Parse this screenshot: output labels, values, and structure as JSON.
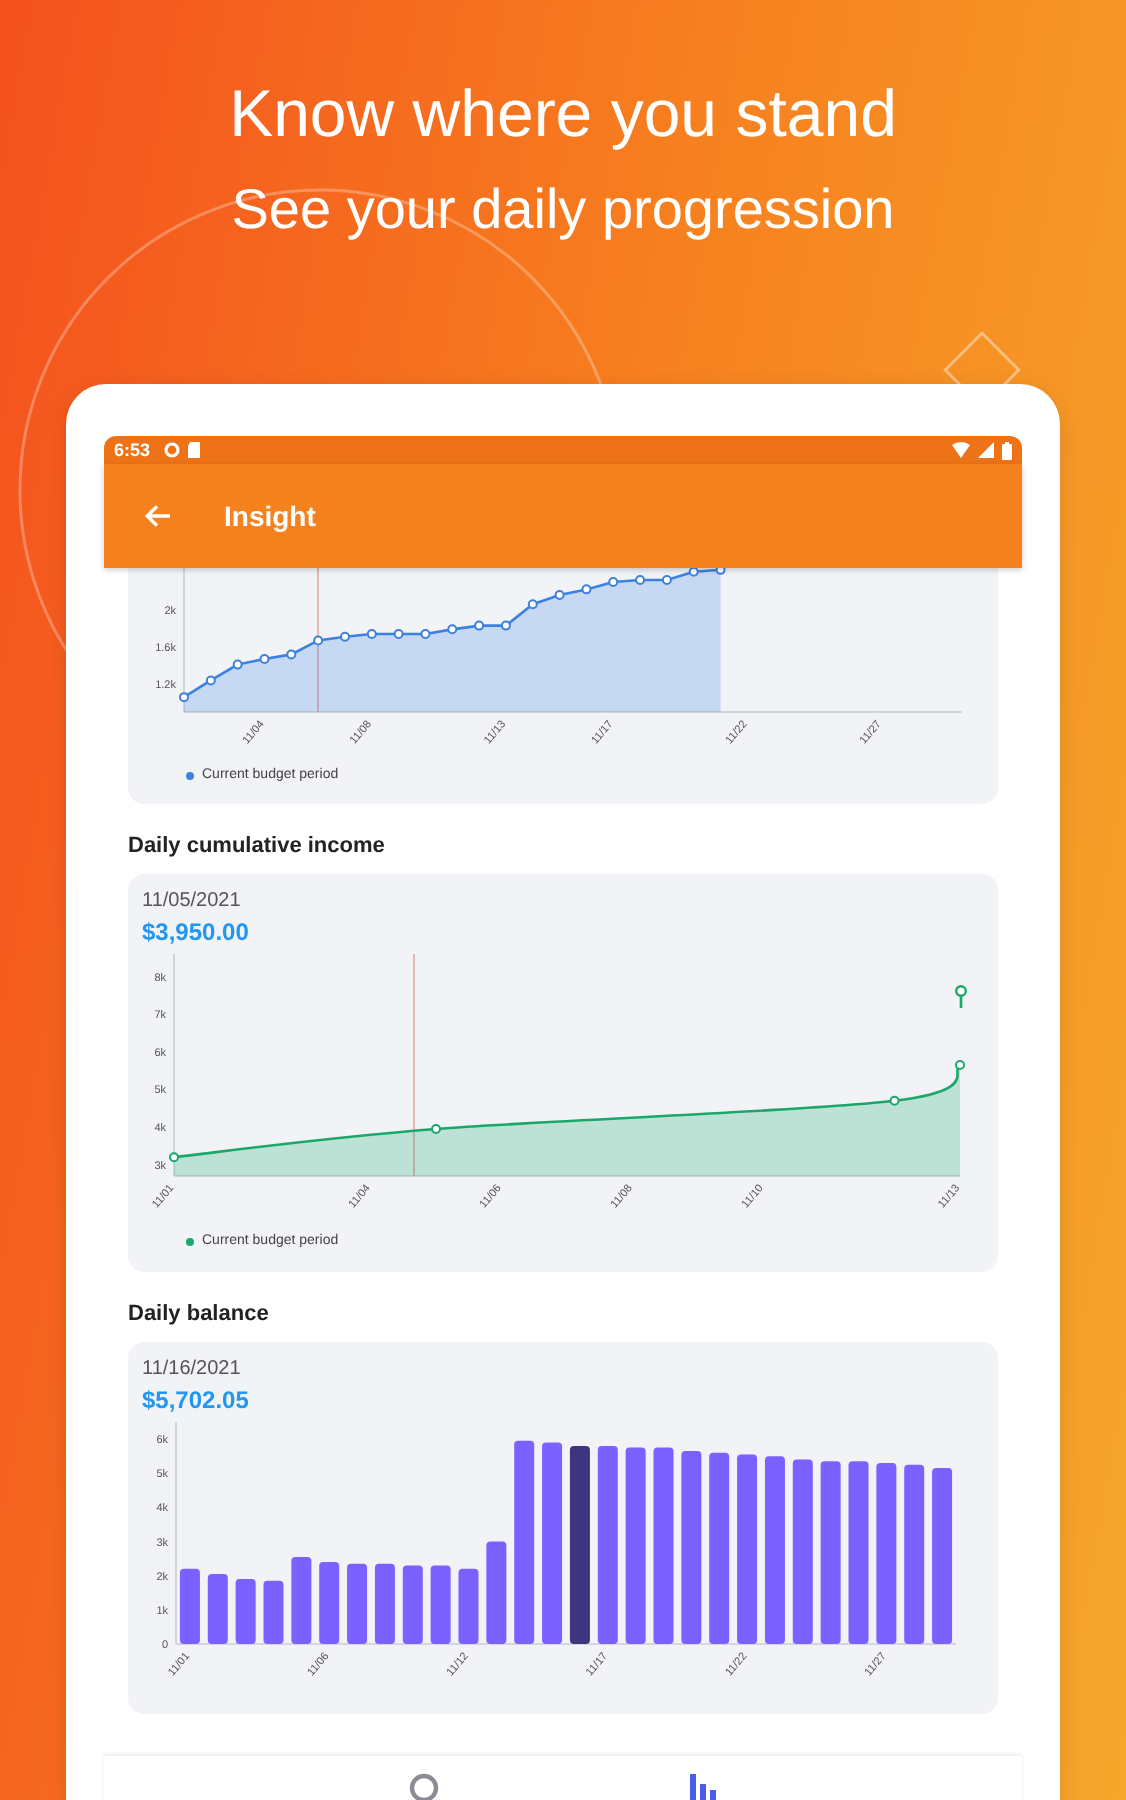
{
  "headline": {
    "title": "Know where you stand",
    "subtitle": "See your daily progression"
  },
  "status_bar": {
    "time": "6:53"
  },
  "app_bar": {
    "title": "Insight"
  },
  "sections": [
    {
      "chart_data": {
        "type": "area",
        "categories": [
          null,
          null,
          null,
          "11/04",
          null,
          null,
          null,
          "11/08",
          null,
          null,
          null,
          null,
          "11/13",
          null,
          null,
          null,
          "11/17",
          null,
          null,
          null,
          null,
          "11/22",
          null,
          null,
          null,
          null,
          "11/27",
          null,
          null,
          null
        ],
        "ylim": [
          900,
          2450
        ],
        "yticks": [
          {
            "value": 1200,
            "label": "1.2k"
          },
          {
            "value": 1600,
            "label": "1.6k"
          },
          {
            "value": 2000,
            "label": "2k"
          }
        ],
        "series": [
          {
            "name": "Current budget period",
            "color": "#3b82e0",
            "values": [
              1060,
              1240,
              1410,
              1470,
              1520,
              1670,
              1710,
              1740,
              1740,
              1740,
              1790,
              1830,
              1830,
              2060,
              2160,
              2220,
              2300,
              2320,
              2320,
              2410,
              2430,
              null,
              null,
              null,
              null,
              null,
              null,
              null,
              null,
              null
            ]
          }
        ]
      }
    },
    {
      "title": "Daily cumulative income",
      "selected_date": "11/05/2021",
      "selected_value": "$3,950.00",
      "chart_data": {
        "type": "area",
        "categories": [
          "11/01",
          null,
          null,
          "11/04",
          null,
          "11/06",
          null,
          "11/08",
          null,
          "11/10",
          null,
          null,
          "11/13"
        ],
        "ylim": [
          2700,
          8600
        ],
        "yticks": [
          {
            "value": 3000,
            "label": "3k"
          },
          {
            "value": 4000,
            "label": "4k"
          },
          {
            "value": 5000,
            "label": "5k"
          },
          {
            "value": 6000,
            "label": "6k"
          },
          {
            "value": 7000,
            "label": "7k"
          },
          {
            "value": 8000,
            "label": "8k"
          }
        ],
        "series": [
          {
            "name": "Current budget period",
            "color": "#1aa86a",
            "values": [
              3200,
              null,
              null,
              null,
              3950,
              null,
              null,
              null,
              null,
              null,
              null,
              4700,
              5650
            ]
          }
        ]
      }
    },
    {
      "title": "Daily balance",
      "selected_date": "11/16/2021",
      "selected_value": "$5,702.05",
      "chart_data": {
        "type": "bar",
        "categories": [
          "11/01",
          null,
          null,
          null,
          null,
          "11/06",
          null,
          null,
          null,
          null,
          "11/12",
          null,
          null,
          null,
          null,
          "11/17",
          null,
          null,
          null,
          null,
          "11/22",
          null,
          null,
          null,
          null,
          "11/27",
          null,
          null
        ],
        "ylim": [
          0,
          6500
        ],
        "yticks": [
          {
            "value": 0,
            "label": "0"
          },
          {
            "value": 1000,
            "label": "1k"
          },
          {
            "value": 2000,
            "label": "2k"
          },
          {
            "value": 3000,
            "label": "3k"
          },
          {
            "value": 4000,
            "label": "4k"
          },
          {
            "value": 5000,
            "label": "5k"
          },
          {
            "value": 6000,
            "label": "6k"
          }
        ],
        "series": [
          {
            "color": "#7b61ff",
            "values": [
              2200,
              2050,
              1900,
              1850,
              2550,
              2400,
              2350,
              2350,
              2300,
              2300,
              2200,
              3000,
              5950,
              5900,
              null,
              5800,
              5750,
              5750,
              5650,
              5600,
              5550,
              5500,
              5400,
              5350,
              5350,
              5300,
              5250,
              5150
            ]
          },
          {
            "color": "#3f3480",
            "values": [
              null,
              null,
              null,
              null,
              null,
              null,
              null,
              null,
              null,
              null,
              null,
              null,
              null,
              null,
              5800,
              null,
              null,
              null,
              null,
              null,
              null,
              null,
              null,
              null,
              null,
              null,
              null,
              null
            ]
          }
        ]
      }
    }
  ],
  "bottom_nav": [
    {
      "kind": "donut",
      "selected": false
    },
    {
      "kind": "bars",
      "selected": true
    }
  ]
}
